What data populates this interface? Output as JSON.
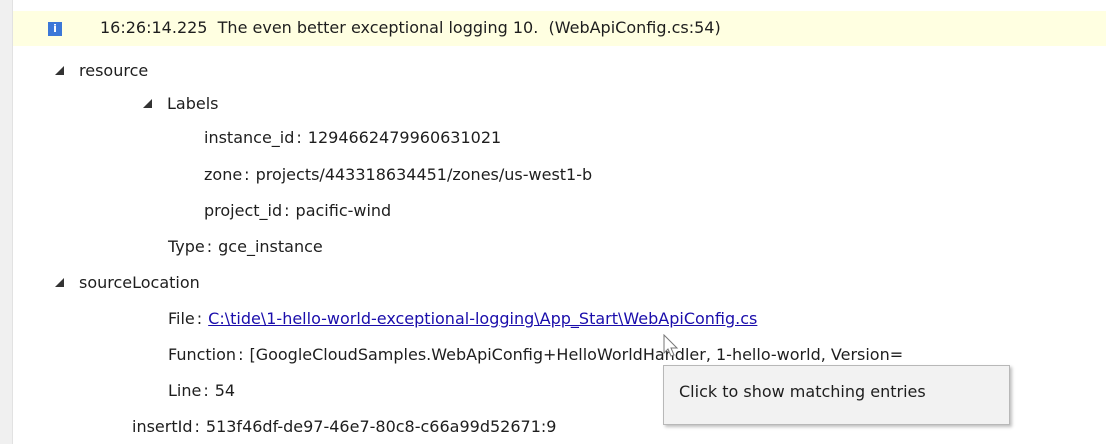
{
  "header": {
    "timestamp": "16:26:14.225",
    "message": "The even better exceptional logging 10.",
    "source": "(WebApiConfig.cs:54)"
  },
  "tree": {
    "resource": "resource",
    "labels": "Labels",
    "instance_id_key": "instance_id",
    "instance_id_val": "1294662479960631021",
    "zone_key": "zone",
    "zone_val": "projects/443318634451/zones/us-west1-b",
    "project_id_key": "project_id",
    "project_id_val": "pacific-wind",
    "type_key": "Type",
    "type_val": "gce_instance",
    "source_location": "sourceLocation",
    "file_key": "File",
    "file_val": "C:\\tide\\1-hello-world-exceptional-logging\\App_Start\\WebApiConfig.cs",
    "function_key": "Function",
    "function_val": "[GoogleCloudSamples.WebApiConfig+HelloWorldHandler, 1-hello-world, Version=",
    "line_key": "Line",
    "line_val": "54",
    "insert_id_key": "insertId",
    "insert_id_val": "513f46df-de97-46e7-80c8-c66a99d52671:9"
  },
  "tooltip": {
    "text": "Click to show matching entries"
  },
  "colors": {
    "header_bg": "#ffffe1",
    "link": "#1a0dab",
    "info_icon": "#3c78d8"
  }
}
